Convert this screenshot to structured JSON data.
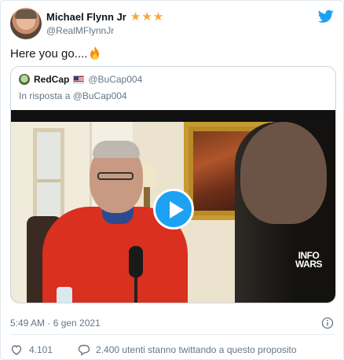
{
  "author": {
    "display_name": "Michael Flynn Jr",
    "handle": "@RealMFlynnJr",
    "badge_icons": [
      "star-icon",
      "star-icon",
      "star-icon"
    ],
    "badge_color": "#f2a93b"
  },
  "brand": {
    "logo_icon": "twitter-bird-icon",
    "accent_color": "#1da1f2"
  },
  "tweet": {
    "text": "Here you go....",
    "emoji_icon": "fire-icon"
  },
  "quoted": {
    "display_name": "RedCap",
    "flag_icon": "us-flag-icon",
    "handle": "@BuCap004",
    "reply_context": "In risposta a @BuCap004",
    "video": {
      "play_icon": "play-icon",
      "watermark_lines": [
        "INFO",
        "WARS"
      ]
    }
  },
  "meta": {
    "timestamp": "5:49 AM · 6 gen 2021",
    "info_icon": "info-icon"
  },
  "actions": {
    "like_icon": "heart-icon",
    "like_count": "4.101",
    "reply_icon": "speech-bubble-icon",
    "talking_text": "2.400 utenti stanno twittando a questo proposito"
  }
}
